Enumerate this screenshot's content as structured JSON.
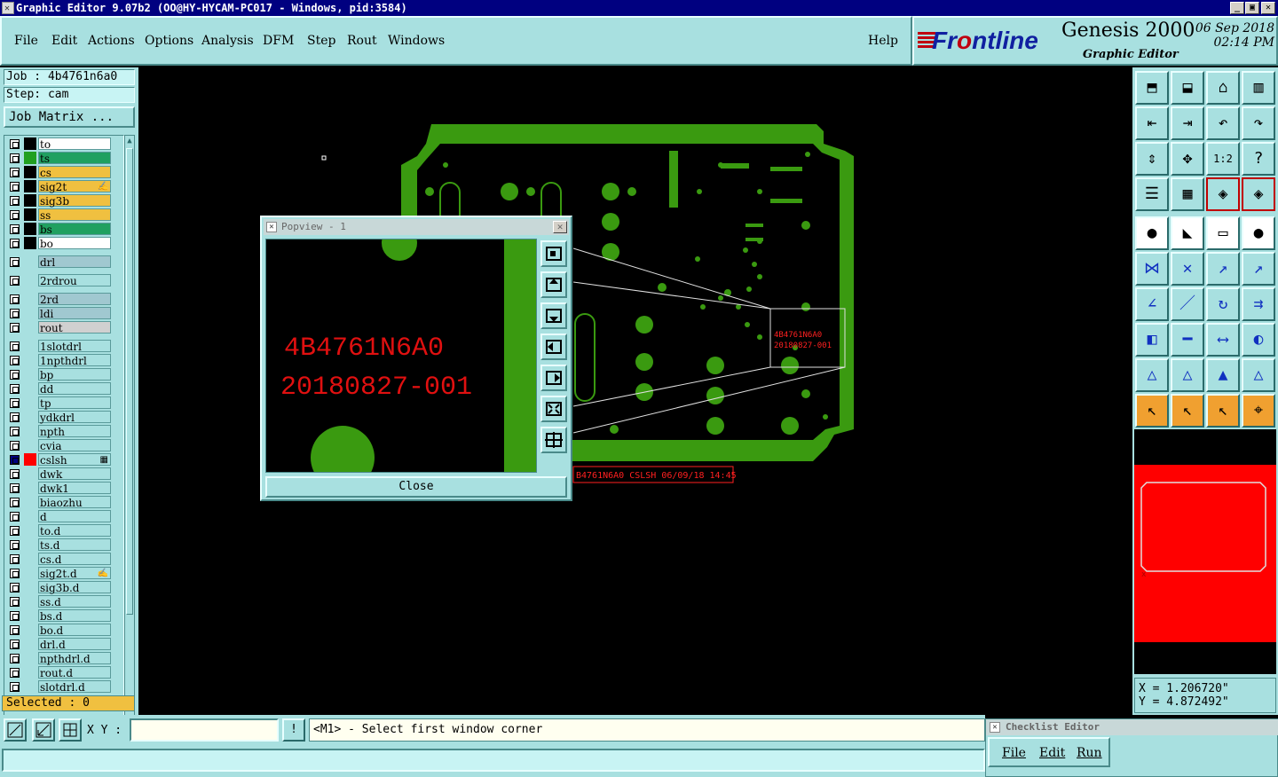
{
  "window": {
    "title": "Graphic Editor 9.07b2 (OO@HY-HYCAM-PC017 - Windows, pid:3584)",
    "min_label": "_",
    "max_label": "▣",
    "close_label": "✕"
  },
  "menu": {
    "items": [
      "File",
      "Edit",
      "Actions",
      "Options",
      "Analysis",
      "DFM",
      "Step",
      "Rout",
      "Windows"
    ],
    "help": "Help"
  },
  "brand": {
    "logo_pre": "Fr",
    "logo_o": "o",
    "logo_post": "ntline",
    "product": "Genesis 2000",
    "subtitle": "Graphic Editor",
    "date": "06 Sep 2018",
    "time": "02:14 PM"
  },
  "job": {
    "job_label": "Job : 4b4761n6a0",
    "step_label": "Step: cam",
    "matrix_button": "Job Matrix ..."
  },
  "layers": [
    {
      "name": "to",
      "color": "#000000",
      "bg": "#ffffff"
    },
    {
      "name": "ts",
      "color": "#20a020",
      "bg": "#20a060"
    },
    {
      "name": "cs",
      "color": "#000000",
      "bg": "#f0c040"
    },
    {
      "name": "sig2t",
      "color": "#000000",
      "bg": "#f0c040",
      "mark": "✍"
    },
    {
      "name": "sig3b",
      "color": "#000000",
      "bg": "#f0c040"
    },
    {
      "name": "ss",
      "color": "#000000",
      "bg": "#f0c040"
    },
    {
      "name": "bs",
      "color": "#000000",
      "bg": "#20a060"
    },
    {
      "name": "bo",
      "color": "#000000",
      "bg": "#ffffff"
    },
    {
      "name": "drl",
      "color": "",
      "bg": "#a0c8d0"
    },
    {
      "name": "2rdrou",
      "color": "",
      "bg": "#a8e0e0"
    },
    {
      "name": "2rd",
      "color": "",
      "bg": "#a0c8d0"
    },
    {
      "name": "ldi",
      "color": "",
      "bg": "#a0c8d0"
    },
    {
      "name": "rout",
      "color": "",
      "bg": "#d0d0d0"
    },
    {
      "name": "1slotdrl",
      "color": "",
      "bg": "#a8e0e0"
    },
    {
      "name": "1npthdrl",
      "color": "",
      "bg": "#a8e0e0"
    },
    {
      "name": "bp",
      "color": "",
      "bg": "#a8e0e0"
    },
    {
      "name": "dd",
      "color": "",
      "bg": "#a8e0e0"
    },
    {
      "name": "tp",
      "color": "",
      "bg": "#a8e0e0"
    },
    {
      "name": "ydkdrl",
      "color": "",
      "bg": "#a8e0e0"
    },
    {
      "name": "npth",
      "color": "",
      "bg": "#a8e0e0"
    },
    {
      "name": "cvia",
      "color": "",
      "bg": "#a8e0e0"
    },
    {
      "name": "cslsh",
      "color": "#ff0000",
      "bg": "#a8e0e0",
      "mark": "▦",
      "active": true
    },
    {
      "name": "dwk",
      "color": "",
      "bg": "#a8e0e0"
    },
    {
      "name": "dwk1",
      "color": "",
      "bg": "#a8e0e0"
    },
    {
      "name": "biaozhu",
      "color": "",
      "bg": "#a8e0e0"
    },
    {
      "name": "d",
      "color": "",
      "bg": "#a8e0e0"
    },
    {
      "name": "to.d",
      "color": "",
      "bg": "#a8e0e0"
    },
    {
      "name": "ts.d",
      "color": "",
      "bg": "#a8e0e0"
    },
    {
      "name": "cs.d",
      "color": "",
      "bg": "#a8e0e0"
    },
    {
      "name": "sig2t.d",
      "color": "",
      "bg": "#a8e0e0",
      "mark": "✍"
    },
    {
      "name": "sig3b.d",
      "color": "",
      "bg": "#a8e0e0"
    },
    {
      "name": "ss.d",
      "color": "",
      "bg": "#a8e0e0"
    },
    {
      "name": "bs.d",
      "color": "",
      "bg": "#a8e0e0"
    },
    {
      "name": "bo.d",
      "color": "",
      "bg": "#a8e0e0"
    },
    {
      "name": "drl.d",
      "color": "",
      "bg": "#a8e0e0"
    },
    {
      "name": "npthdrl.d",
      "color": "",
      "bg": "#a8e0e0"
    },
    {
      "name": "rout.d",
      "color": "",
      "bg": "#a8e0e0"
    },
    {
      "name": "slotdrl.d",
      "color": "",
      "bg": "#a8e0e0"
    }
  ],
  "selected": "Selected : 0",
  "popview": {
    "title": "Popview - 1",
    "text_line1": "4B4761N6A0",
    "text_line2": "20180827-001",
    "close_button": "Close"
  },
  "canvas_labels": {
    "stamp": "B4761N6A0 CSLSH 06/09/18 14:45",
    "small_line1": "4B4761N6A0",
    "small_line2": "20180827-001"
  },
  "coords": {
    "x": "X = 1.206720\"",
    "y": "Y = 4.872492\""
  },
  "bottom": {
    "xy_label": "X Y :",
    "xy_value": "",
    "info_label": "!",
    "prompt": "<M1> - Select first window corner"
  },
  "checklist": {
    "title": "Checklist Editor",
    "menu": [
      "File",
      "Edit",
      "Run"
    ]
  },
  "colors": {
    "panel": "#a8e0e0",
    "board": "#3a9a10",
    "highlight_red": "#ff0000"
  }
}
